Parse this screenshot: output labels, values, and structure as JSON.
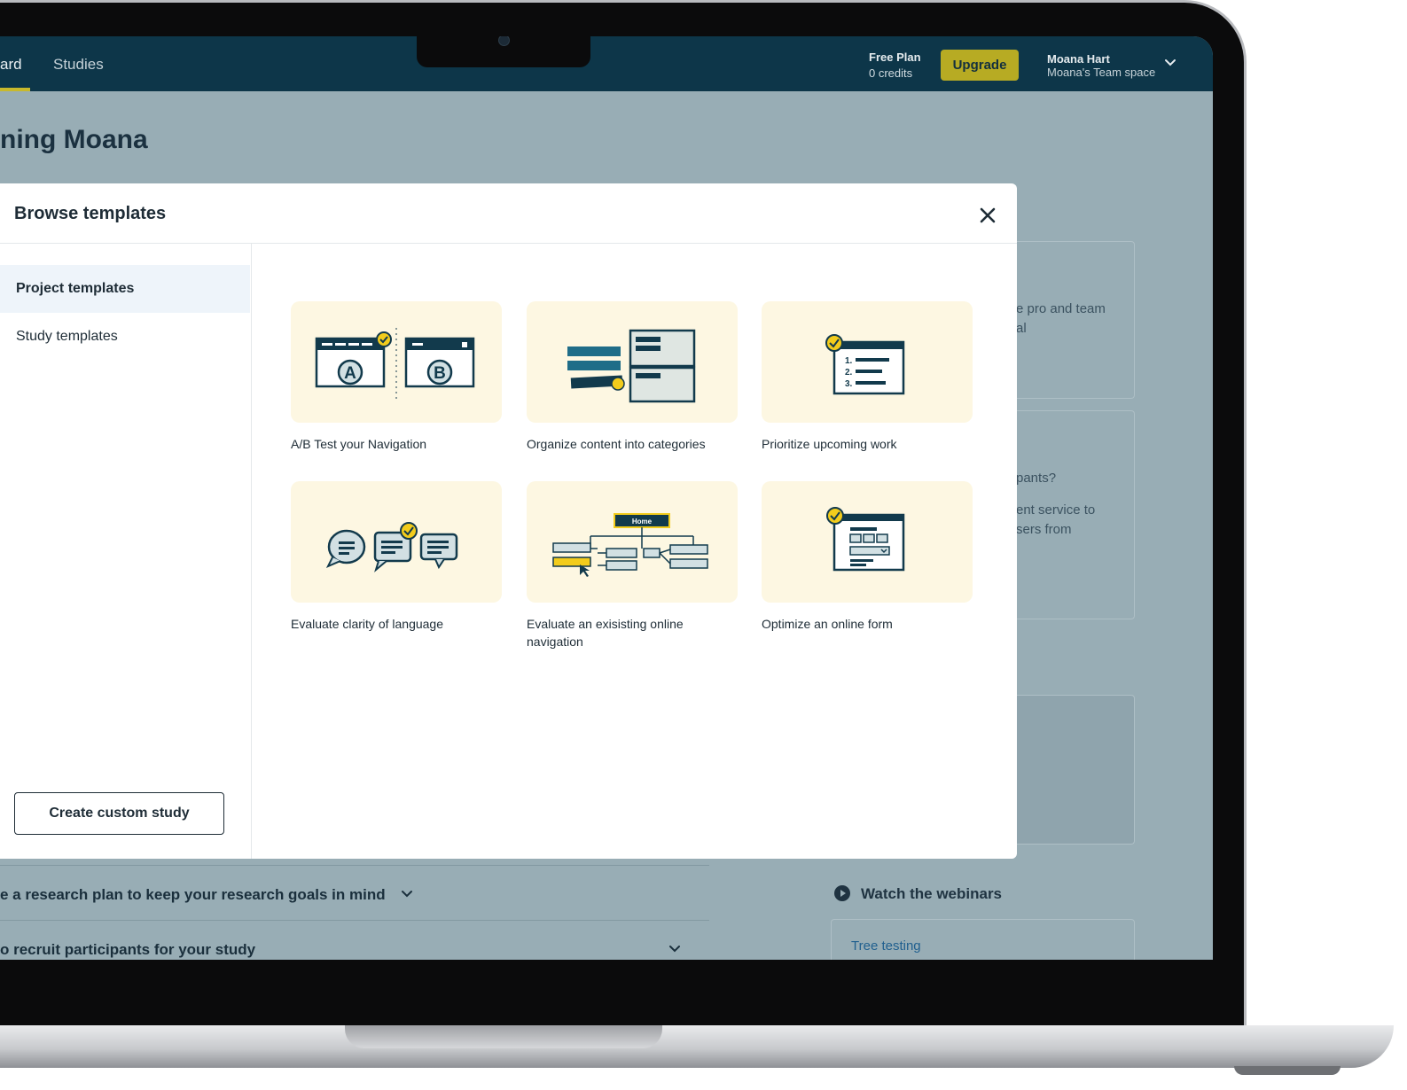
{
  "nav": {
    "tabs": [
      {
        "label": "ard"
      },
      {
        "label": "Studies"
      }
    ],
    "plan_name": "Free Plan",
    "plan_credits": "0 credits",
    "upgrade_label": "Upgrade",
    "user_name": "Moana Hart",
    "user_space": "Moana's Team space"
  },
  "dashboard": {
    "greeting": "ning Moana",
    "side_text": {
      "line1": "e pro and team",
      "line2": "al",
      "line3": "pants?",
      "line4": "ent service to",
      "line5": "sers from"
    },
    "accordion": [
      {
        "label": "e a research plan to keep your research goals in mind"
      },
      {
        "label": "o recruit participants for your study"
      }
    ],
    "webinars_title": "Watch the webinars",
    "webinar_link": "Tree testing"
  },
  "modal": {
    "title": "Browse templates",
    "sidebar": [
      {
        "label": "Project templates"
      },
      {
        "label": "Study templates"
      }
    ],
    "create_custom_label": "Create custom study",
    "templates": [
      {
        "label": "A/B Test your Navigation",
        "icon": "ab-test-icon"
      },
      {
        "label": "Organize content into categories",
        "icon": "card-sort-icon"
      },
      {
        "label": "Prioritize upcoming work",
        "icon": "ordered-list-icon"
      },
      {
        "label": "Evaluate clarity of language",
        "icon": "speech-bubbles-icon"
      },
      {
        "label": "Evaluate an exisisting online navigation",
        "icon": "tree-navigation-icon",
        "home_label": "Home"
      },
      {
        "label": "Optimize an online form",
        "icon": "form-icon"
      }
    ]
  },
  "colors": {
    "nav_bg": "#0d3649",
    "accent": "#b7ab23",
    "overlay": "#98adb5",
    "tile_bg": "#fdf7e2",
    "illustration_dark": "#123a4c",
    "check_yellow": "#f2cc1c"
  }
}
